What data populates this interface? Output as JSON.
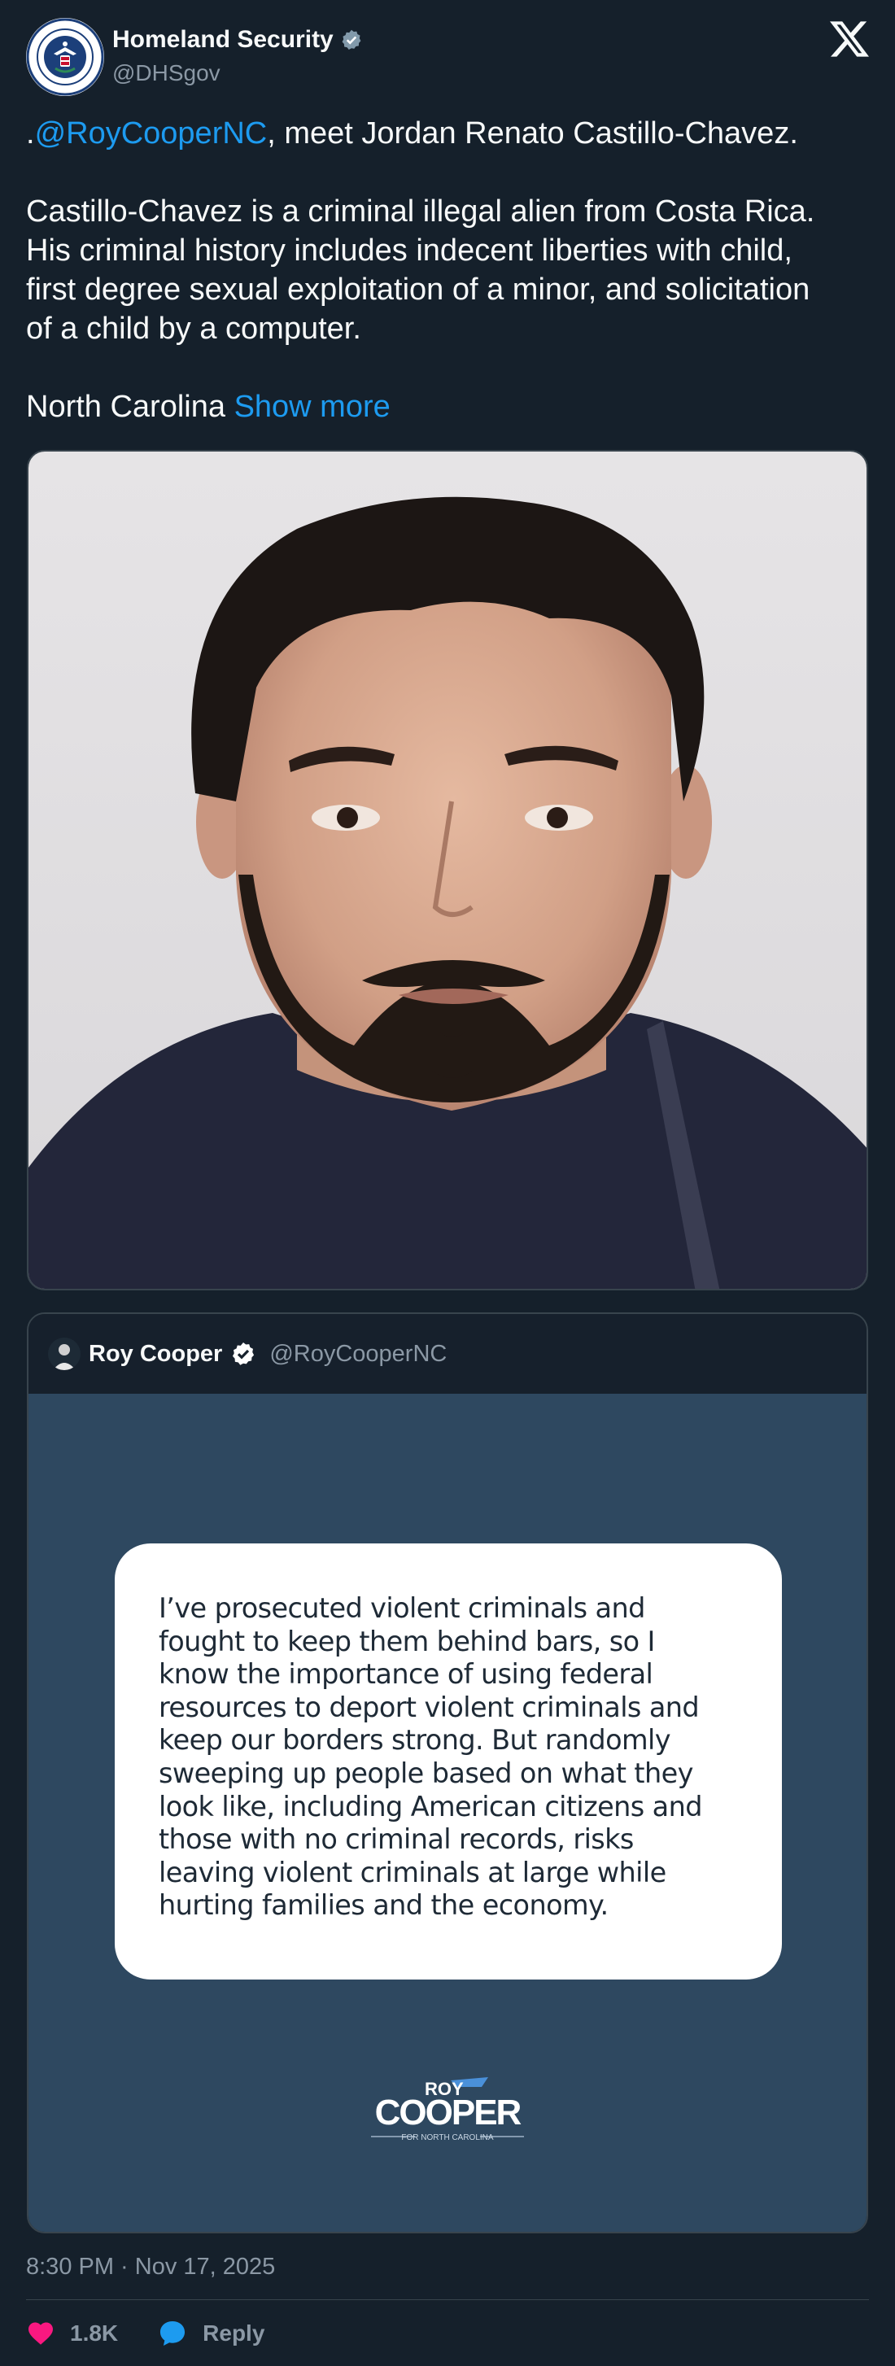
{
  "author": {
    "display_name": "Homeland Security",
    "handle": "@DHSgov",
    "avatar": "dhs-seal-icon",
    "verified": "gray-verified-badge-icon"
  },
  "tweet": {
    "lines": [
      {
        "prefix": ".",
        "mention": "@RoyCooperNC",
        "rest": ", meet Jordan Renato Castillo-Chavez."
      },
      {
        "text": "Castillo-Chavez is a criminal illegal alien from Costa Rica."
      },
      {
        "text": "His criminal history includes indecent liberties with child,"
      },
      {
        "text": "first degree sexual exploitation of a minor, and solicitation"
      },
      {
        "text": "of a child by a computer."
      },
      {
        "text": "North Carolina",
        "show_more": "Show more"
      }
    ]
  },
  "quoted": {
    "display_name": "Roy Cooper",
    "handle": "@RoyCooperNC",
    "verified": "blue-verified-badge-icon",
    "statement_lines": [
      "I’ve prosecuted violent criminals and",
      "fought to keep them behind bars, so I",
      "know the importance of using federal",
      "resources to deport violent criminals and",
      "keep our borders strong. But randomly",
      "sweeping up people based on what they",
      "look like, including American citizens and",
      "those with no criminal records, risks",
      "leaving violent criminals at large while",
      "hurting families and the economy."
    ],
    "logo": {
      "line1": "ROY",
      "line2": "COOPER",
      "tagline": "FOR NORTH CAROLINA"
    }
  },
  "meta": {
    "timestamp": "8:30 PM · Nov 17, 2025",
    "likes": "1.8K",
    "reply_label": "Reply"
  },
  "colors": {
    "background": "#15202b",
    "link": "#1d9bf0",
    "like": "#f91880",
    "muted": "#8b98a5",
    "quote_panel": "#2e4860"
  }
}
